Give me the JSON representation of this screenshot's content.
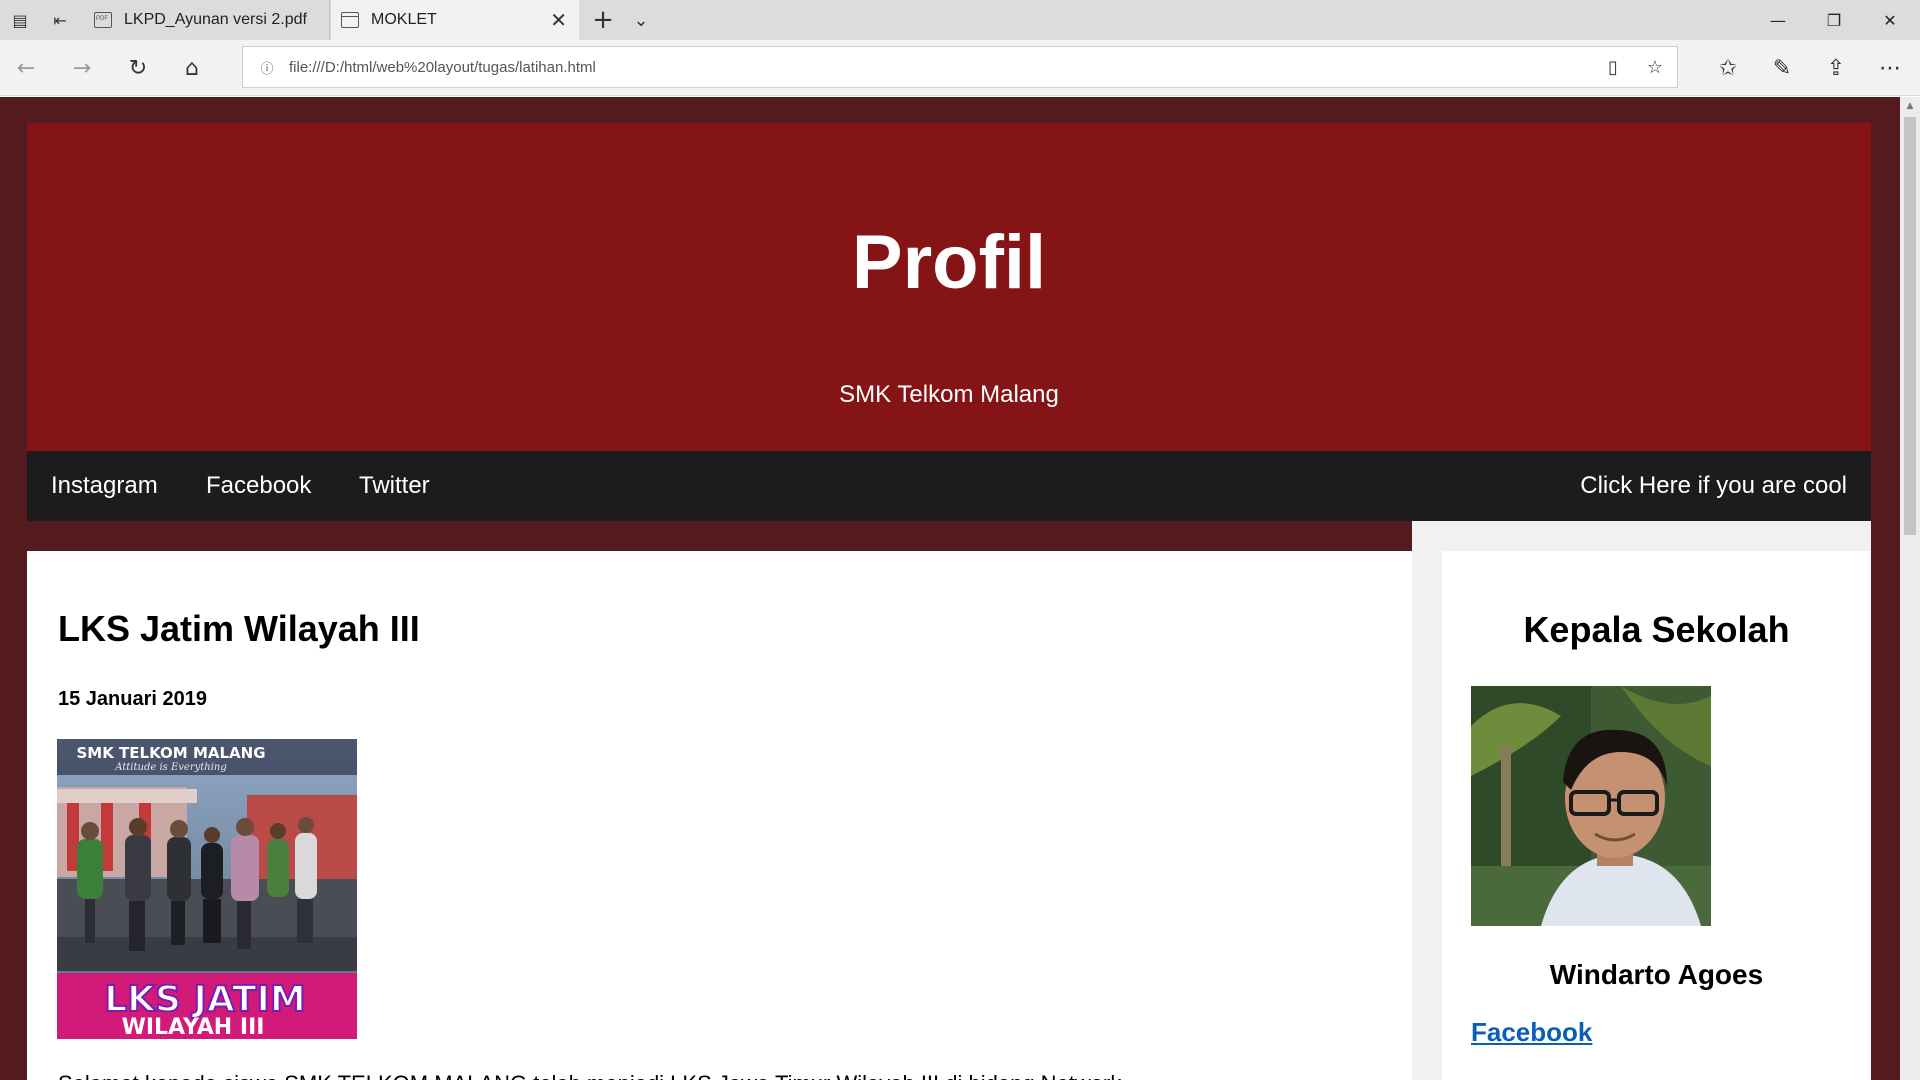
{
  "browser": {
    "tabs": [
      {
        "label": "LKPD_Ayunan versi 2.pdf",
        "active": false,
        "icon": "pdf-file-icon"
      },
      {
        "label": "MOKLET",
        "active": true,
        "icon": "page-icon"
      }
    ],
    "address": "file:///D:/html/web%20layout/tugas/latihan.html",
    "glyphs": {
      "tab_actions": "▤",
      "tab_aside": "⇤",
      "close": "✕",
      "new_tab": "+",
      "tab_list": "⌄",
      "minimize": "—",
      "restore": "❐",
      "back": "←",
      "forward": "→",
      "refresh": "↻",
      "home": "⌂",
      "info": "ⓘ",
      "reading_view": "▯",
      "favorite": "☆",
      "favorites_hub": "✩",
      "notes": "✎",
      "share": "⇪",
      "more": "⋯",
      "scroll_up": "▲"
    }
  },
  "page": {
    "header": {
      "title": "Profil",
      "subtitle": "SMK Telkom Malang"
    },
    "nav": {
      "links": [
        "Instagram",
        "Facebook",
        "Twitter"
      ],
      "right_link": "Click Here if you are cool"
    },
    "article": {
      "title": "LKS Jatim Wilayah III",
      "date": "15 Januari 2019",
      "image": {
        "banner_top": "SMK TELKOM MALANG",
        "tagline": "Attitude is Everything",
        "banner_line1": "LKS JATIM",
        "banner_line2": "WILAYAH III"
      },
      "paragraph_start": "Selamat kepada siswa SMK TELKOM MALANG telah menjadi LKS Jawa Timur Wilayah III di bidang Network"
    },
    "sidebar": {
      "title": "Kepala Sekolah",
      "name": "Windarto Agoes",
      "link": "Facebook"
    }
  },
  "colors": {
    "page_bg": "#541b1f",
    "header_bg": "#851417",
    "nav_bg": "#1c1c1c",
    "link": "#0a5fb4",
    "banner_magenta": "#d21b78"
  }
}
